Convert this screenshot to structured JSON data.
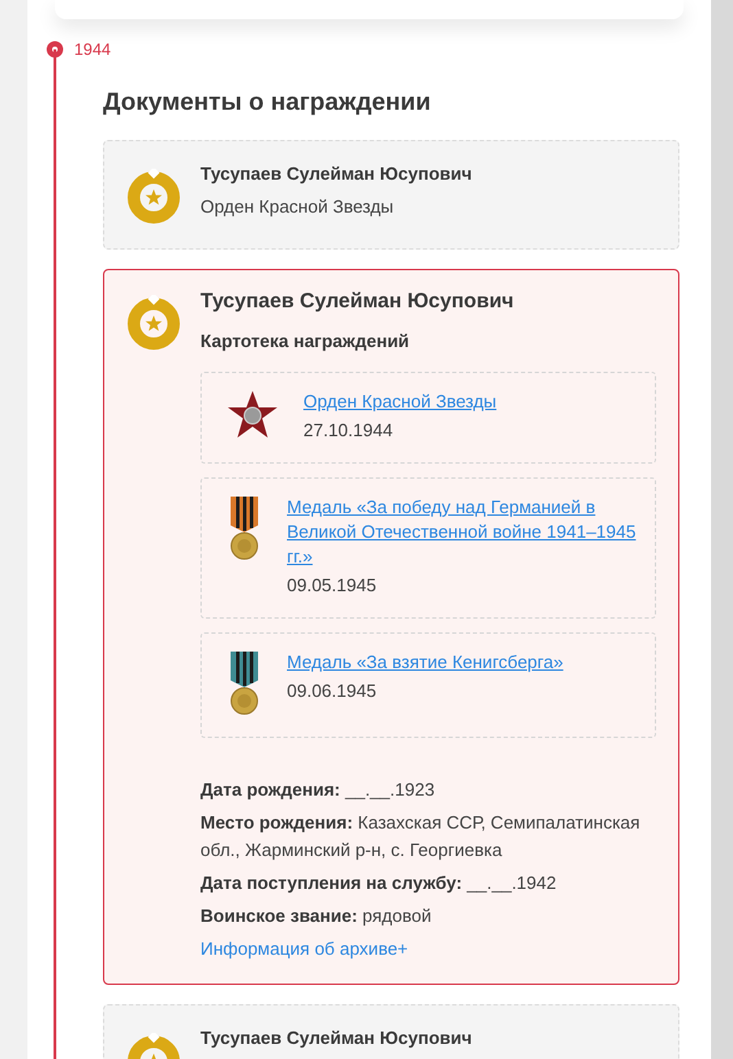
{
  "timeline": {
    "year": "1944"
  },
  "section_title": "Документы о награждении",
  "cards": [
    {
      "name": "Тусупаев Сулейман Юсупович",
      "subtitle": "Орден Красной Звезды",
      "expanded": false
    },
    {
      "name": "Тусупаев Сулейман Юсупович",
      "subtitle": "Картотека награждений",
      "expanded": true,
      "awards": [
        {
          "kind": "star_order",
          "title": "Орден Красной Звезды",
          "date": "27.10.1944"
        },
        {
          "kind": "orange_ribbon_medal",
          "title": "Медаль «За победу над Германией в Великой Отечественной войне 1941–1945 гг.»",
          "date": "09.05.1945"
        },
        {
          "kind": "blue_ribbon_medal",
          "title": "Медаль «За взятие Кенигсберга»",
          "date": "09.06.1945"
        }
      ],
      "details": [
        "**Дата рождения:** __.__.1923",
        "**Место рождения:** Казахская ССР, Семипалатинская обл., Жарминский р-н, с. Георгиевка",
        "**Дата поступления на службу:** __.__.1942",
        "**Воинское звание:** рядовой"
      ],
      "archive_link": "Информация об архиве+"
    },
    {
      "name": "Тусупаев Сулейман Юсупович",
      "expanded": false
    }
  ]
}
